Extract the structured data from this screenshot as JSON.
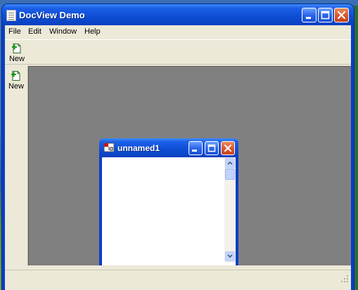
{
  "window": {
    "title": "DocView Demo",
    "controls": [
      "minimize-icon",
      "maximize-icon",
      "close-icon"
    ]
  },
  "menubar": {
    "items": [
      "File",
      "Edit",
      "Window",
      "Help"
    ]
  },
  "toolbar": {
    "new_label": "New",
    "new_icon": "new-document-icon"
  },
  "sidebar": {
    "new_label": "New",
    "new_icon": "new-document-icon"
  },
  "child_window": {
    "title": "unnamed1",
    "icon": "document-app-icon"
  },
  "colors": {
    "titlebar": "#0f4fd6",
    "close_button": "#d9542a",
    "mdi_background": "#808080",
    "window_face": "#ece9d8"
  }
}
